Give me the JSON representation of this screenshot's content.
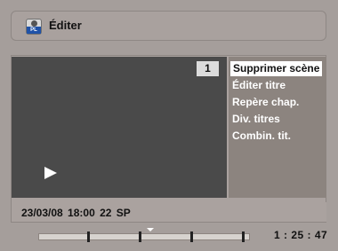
{
  "header": {
    "icon": "playlist-icon",
    "icon_tag": "PL",
    "title": "Éditer"
  },
  "preview": {
    "title_number": "1",
    "play_icon": "play-icon"
  },
  "menu": {
    "items": [
      {
        "label": "Supprimer scène",
        "selected": true
      },
      {
        "label": "Éditer titre",
        "selected": false
      },
      {
        "label": "Repère chap.",
        "selected": false
      },
      {
        "label": "Div. titres",
        "selected": false
      },
      {
        "label": "Combin. tit.",
        "selected": false
      }
    ]
  },
  "info": {
    "date": "23/03/08",
    "time": "18:00",
    "channel": "22",
    "mode": "SP",
    "line": "23/03/08  18:00  22  SP"
  },
  "timeline": {
    "elapsed": "1 : 25 : 47"
  },
  "colors": {
    "background": "#a59e9b",
    "preview": "#4a4a4a",
    "menu": "#8c847f",
    "selection": "#ffffff"
  }
}
